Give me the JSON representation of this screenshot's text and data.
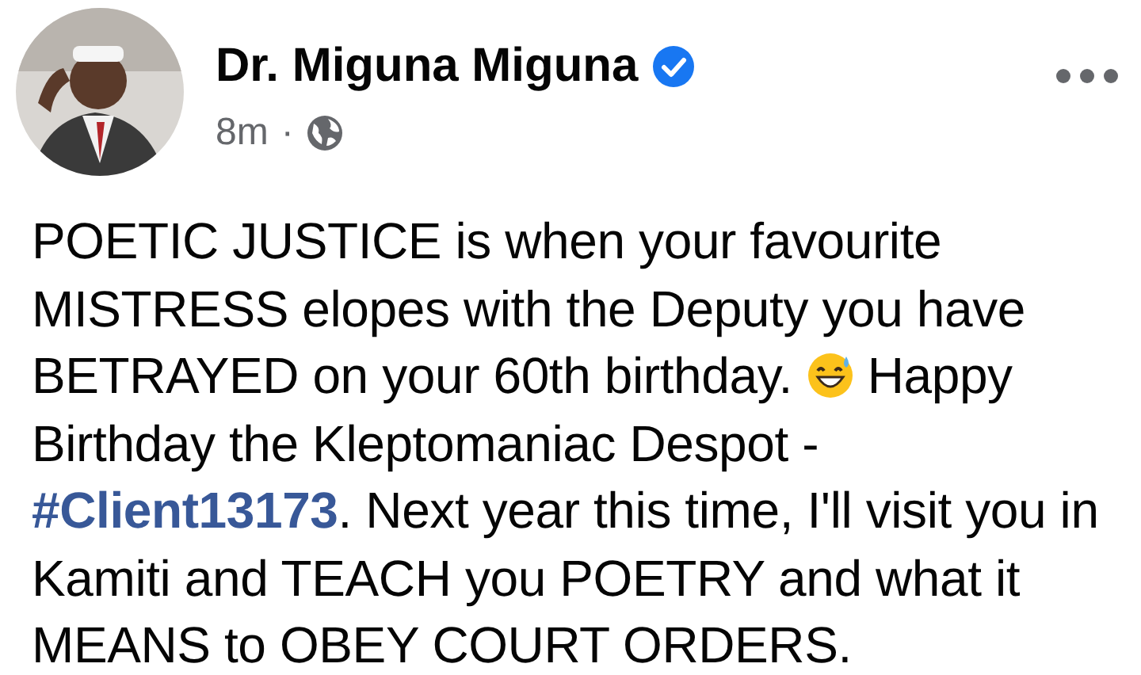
{
  "post": {
    "author": "Dr. Miguna Miguna",
    "verified": true,
    "time": "8m",
    "separator": "·",
    "body": [
      {
        "kind": "text",
        "text": "POETIC JUSTICE is when your favourite MISTRESS elopes with the Deputy you have BETRAYED on your 60th birthday. "
      },
      {
        "kind": "emoji"
      },
      {
        "kind": "text",
        "text": " Happy Birthday the Kleptomaniac Despot - "
      },
      {
        "kind": "hashtag",
        "text": "#Client13173"
      },
      {
        "kind": "text",
        "text": ". Next year this time, I'll visit you in Kamiti and TEACH you POETRY and what it MEANS to OBEY COURT ORDERS."
      }
    ]
  }
}
